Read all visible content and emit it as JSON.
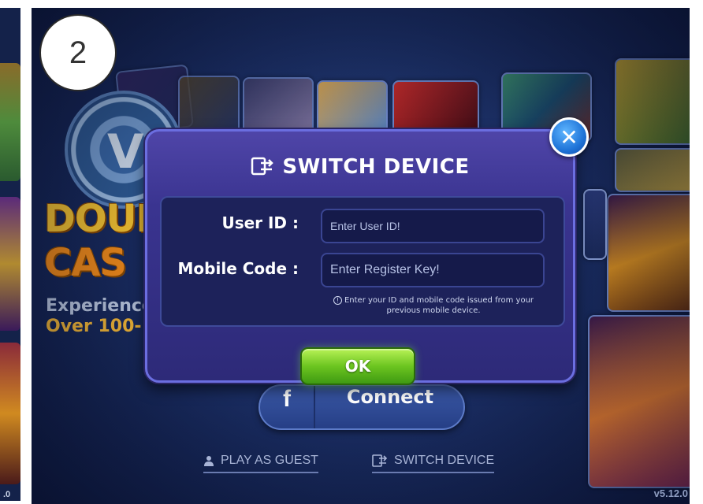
{
  "step": {
    "number": "2"
  },
  "left_strip": {
    "version": ".0"
  },
  "background": {
    "logo_v": "V",
    "logo_line1": "DOUE",
    "logo_line2": "CAS",
    "tagline_1": "Experience",
    "tagline_2": "Over 100-"
  },
  "dialog": {
    "title": "SWITCH DEVICE",
    "title_icon": "switch-device-icon",
    "close_icon": "close-icon",
    "user_id_label": "User ID :",
    "user_id_placeholder": "Enter User ID!",
    "mobile_code_label": "Mobile Code :",
    "mobile_code_placeholder": "Enter Register Key!",
    "hint_icon": "info-icon",
    "hint_text": "Enter your ID and mobile code issued from your previous mobile device.",
    "ok_label": "OK"
  },
  "facebook": {
    "icon": "f",
    "label": "Connect"
  },
  "links": {
    "guest_label": "PLAY AS GUEST",
    "guest_icon": "person-icon",
    "switch_label": "SWITCH DEVICE",
    "switch_icon": "switch-device-icon"
  },
  "version": "v5.12.0",
  "colors": {
    "ok_green": "#6cc520",
    "dialog_purple": "#3a3490",
    "close_blue": "#1f74d8",
    "facebook_blue": "#2f4c98"
  }
}
